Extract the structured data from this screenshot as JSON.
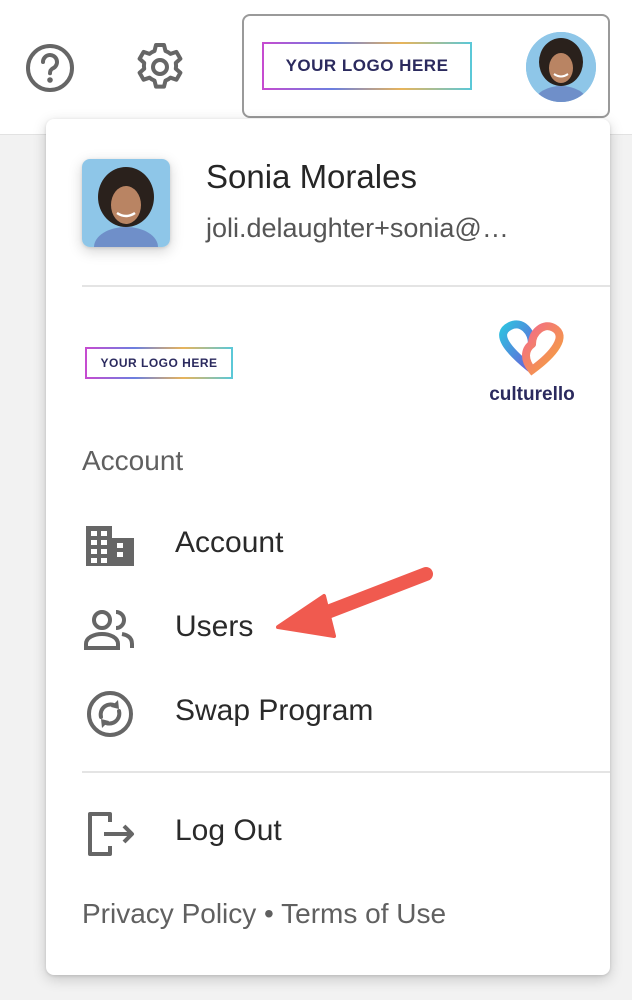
{
  "topbar": {
    "help_icon": "help-circle-icon",
    "settings_icon": "gear-icon",
    "logo_placeholder": "YOUR LOGO HERE"
  },
  "profile": {
    "name": "Sonia Morales",
    "email": "joli.delaughter+sonia@…"
  },
  "brand": {
    "logo_placeholder": "YOUR LOGO HERE",
    "company_wordmark": "culturello"
  },
  "menu": {
    "section_title": "Account",
    "items": [
      {
        "label": "Account",
        "icon": "building-icon"
      },
      {
        "label": "Users",
        "icon": "people-icon"
      },
      {
        "label": "Swap Program",
        "icon": "swap-circle-icon"
      }
    ],
    "logout_label": "Log Out"
  },
  "footer": {
    "privacy": "Privacy Policy",
    "separator": "•",
    "terms": "Terms of Use"
  },
  "colors": {
    "annotation_arrow": "#f05a4f",
    "icon": "#666666",
    "text": "#2e2e2e"
  }
}
